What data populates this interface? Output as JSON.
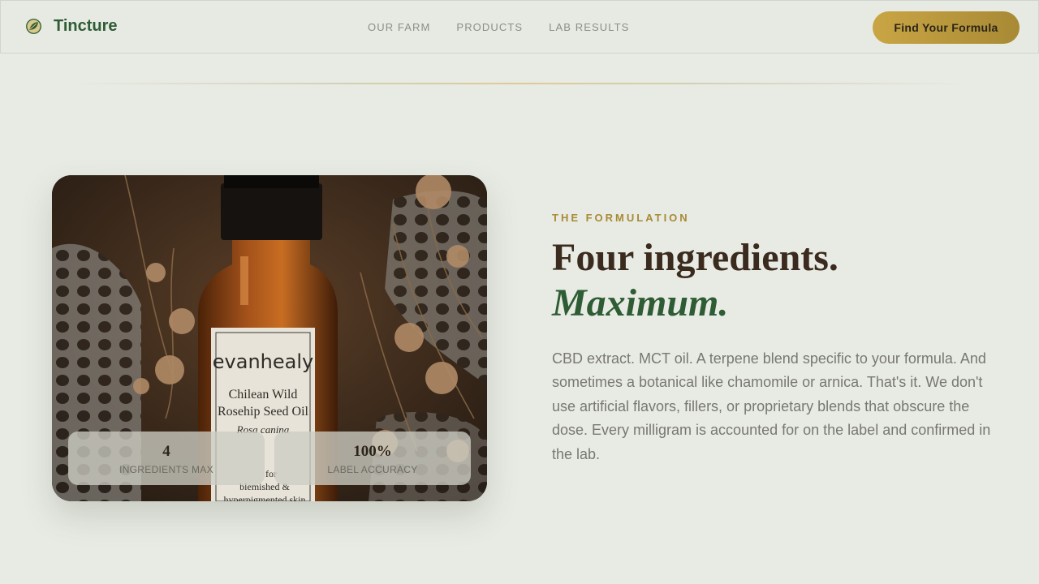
{
  "header": {
    "brand": "Tincture",
    "brand_icon": "leaf-emblem-icon",
    "nav": [
      "OUR FARM",
      "PRODUCTS",
      "LAB RESULTS"
    ],
    "cta_label": "Find Your Formula"
  },
  "hero_image": {
    "label_brand": "evanhealy",
    "label_line1": "Chilean Wild",
    "label_line2": "Rosehip Seed Oil",
    "label_latin": "Rosa canina",
    "label_small1": "blemished &",
    "label_small2": "hyperpigmented skin",
    "label_fragment": "for"
  },
  "stats": [
    {
      "value": "4",
      "label": "INGREDIENTS MAX"
    },
    {
      "value": "100%",
      "label": "LABEL ACCURACY"
    }
  ],
  "section": {
    "eyebrow": "THE FORMULATION",
    "headline": "Four ingredients.",
    "headline_accent": "Maximum.",
    "body": "CBD extract. MCT oil. A terpene blend specific to your formula. And sometimes a botanical like chamomile or arnica. That's it. We don't use artificial flavors, fillers, or proprietary blends that obscure the dose. Every milligram is accounted for on the label and confirmed in the lab."
  },
  "colors": {
    "brand_green": "#2e5c34",
    "gold": "#c9a544",
    "heading": "#3a2b1e",
    "background": "#e8ebe4"
  }
}
